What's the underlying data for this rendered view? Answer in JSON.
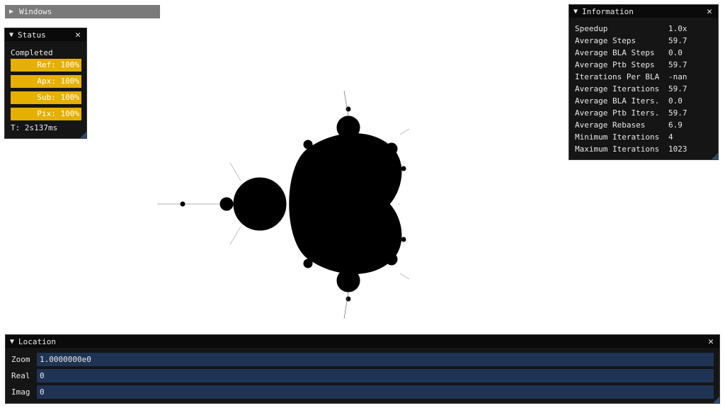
{
  "windows_bar": {
    "label": "Windows"
  },
  "status": {
    "title": "Status",
    "state": "Completed",
    "progress": [
      {
        "label": "Ref: 100%",
        "value": 100
      },
      {
        "label": "Apx: 100%",
        "value": 100
      },
      {
        "label": "Sub: 100%",
        "value": 100
      },
      {
        "label": "Pix: 100%",
        "value": 100
      }
    ],
    "time": "T: 2s137ms"
  },
  "information": {
    "title": "Information",
    "rows": [
      {
        "key": "Speedup",
        "value": "1.0x"
      },
      {
        "key": "Average Steps",
        "value": "59.7"
      },
      {
        "key": "Average BLA Steps",
        "value": "0.0"
      },
      {
        "key": "Average Ptb Steps",
        "value": "59.7"
      },
      {
        "key": "Iterations Per BLA",
        "value": "-nan"
      },
      {
        "key": "Average Iterations",
        "value": "59.7"
      },
      {
        "key": "Average BLA Iters.",
        "value": "0.0"
      },
      {
        "key": "Average Ptb Iters.",
        "value": "59.7"
      },
      {
        "key": "Average Rebases",
        "value": "6.9"
      },
      {
        "key": "Minimum Iterations",
        "value": "4"
      },
      {
        "key": "Maximum Iterations",
        "value": "1023"
      }
    ]
  },
  "location": {
    "title": "Location",
    "zoom_label": "Zoom",
    "zoom_value": "1.0000000e0",
    "real_label": "Real",
    "real_value": "0",
    "imag_label": "Imag",
    "imag_value": "0"
  },
  "colors": {
    "progress_fill": "#e6b000",
    "field_bg": "#1f3454",
    "window_bg": "#151515",
    "fractal": "#000000"
  }
}
